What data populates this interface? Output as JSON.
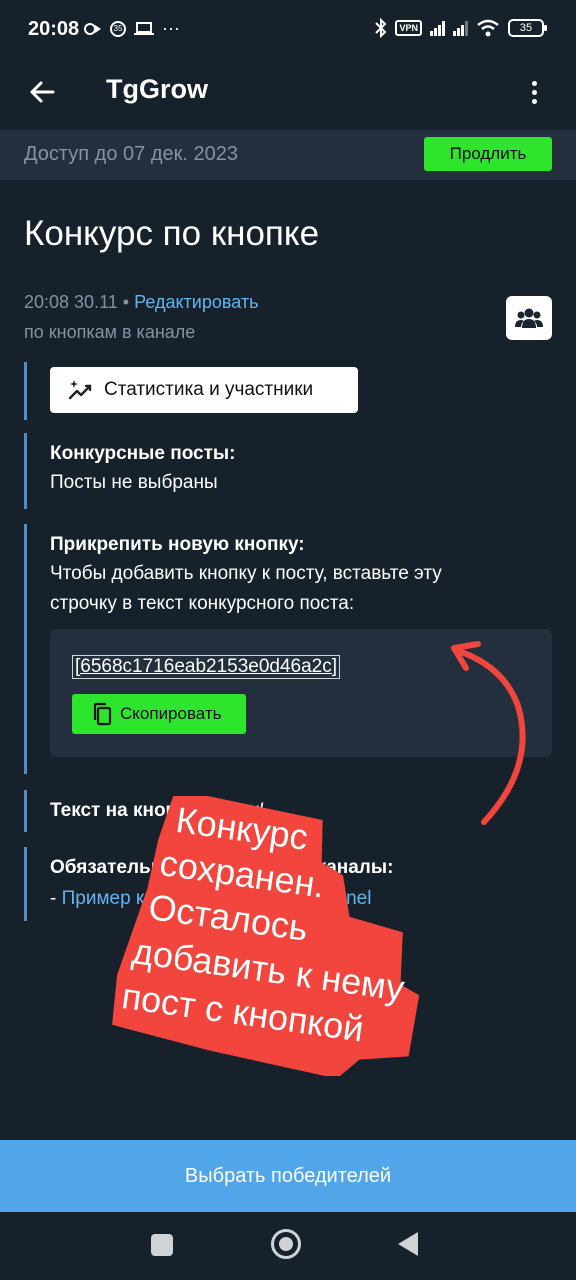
{
  "status_bar": {
    "time": "20:08",
    "notif_badge": "35",
    "more": "···",
    "vpn": "VPN",
    "battery": "35"
  },
  "app_bar": {
    "title": "TgGrow"
  },
  "access": {
    "text": "Доступ до 07 дек. 2023",
    "button": "Продлить"
  },
  "page": {
    "title": "Конкурс по кнопке"
  },
  "meta": {
    "time": "20:08 30.11",
    "separator": "•",
    "edit_link": "Редактировать",
    "subtitle": "по кнопкам в канале"
  },
  "stats_button": "Статистика и участники",
  "posts": {
    "label": "Конкурсные посты:",
    "value": "Посты не выбраны"
  },
  "attach": {
    "label": "Прикрепить новую кнопку:",
    "line1": "Чтобы добавить кнопку к посту, вставьте эту",
    "line2": "строчку в текст конкурсного поста:",
    "code": "[6568c1716eab2153e0d46a2c]",
    "copy_button": "Скопировать"
  },
  "button_text": {
    "label": "Текст на кнопке:",
    "value": "Жмяк!"
  },
  "subscriptions": {
    "label": "Обязательные подписки на каналы:",
    "dash": "-",
    "channel": "Пример канала @example_channel"
  },
  "annotation": {
    "lines": [
      "Конкурс",
      "сохранен.",
      "Осталось",
      "добавить к нему",
      "пост с кнопкой"
    ],
    "color": "#f2453d"
  },
  "bottom_button": "Выбрать победителей",
  "colors": {
    "bg": "#17212b",
    "panel": "#242f3d",
    "green": "#2ee52e",
    "blue": "#50a6e8",
    "link": "#64b5ef"
  }
}
